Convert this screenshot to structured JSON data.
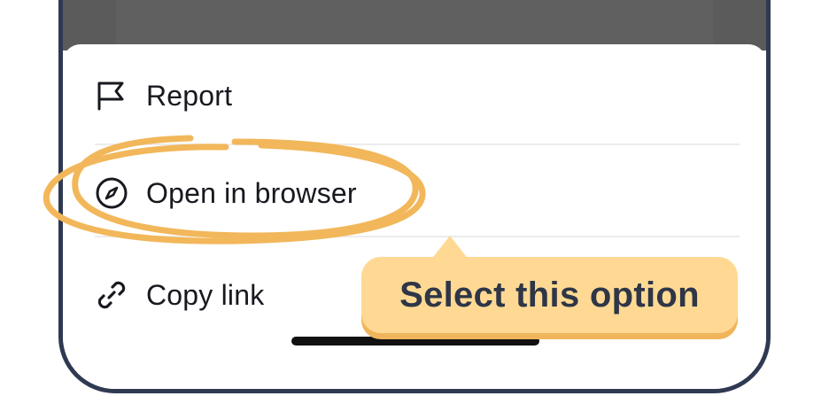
{
  "menu": {
    "items": [
      {
        "label": "Report",
        "icon": "flag-icon"
      },
      {
        "label": "Open in browser",
        "icon": "compass-icon"
      },
      {
        "label": "Copy link",
        "icon": "link-icon"
      }
    ]
  },
  "tooltip": {
    "text": "Select this option"
  },
  "colors": {
    "frame": "#2f3a52",
    "backdrop": "#5b5b5b",
    "highlight": "#f2b75a",
    "tooltip_bg": "#ffd993",
    "tooltip_text": "#2e3647"
  }
}
